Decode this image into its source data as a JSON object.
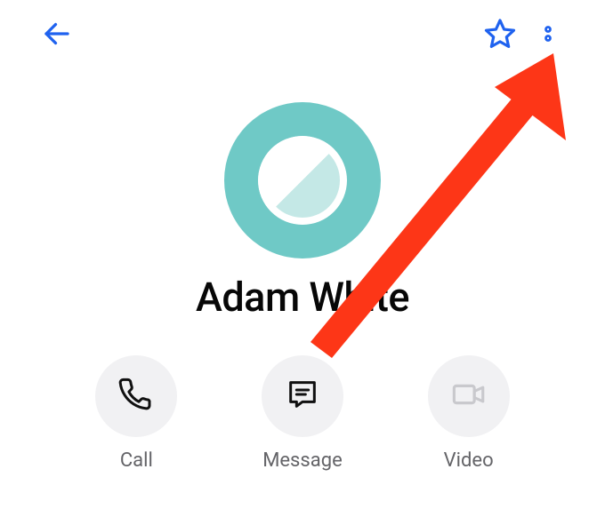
{
  "colors": {
    "accent": "#1f62ef",
    "avatar_bg": "#6fc9c6",
    "avatar_inner": "#c4e8e6",
    "action_bg": "#f1f1f3",
    "annotation": "#fd3617",
    "text_primary": "#070707",
    "text_secondary": "#646468"
  },
  "header": {
    "back_icon": "arrow-left",
    "favorite_icon": "star-outline",
    "menu_icon": "more-vertical"
  },
  "contact": {
    "name": "Adam White",
    "avatar_kind": "blocked-placeholder"
  },
  "actions": [
    {
      "id": "call",
      "label": "Call",
      "icon": "phone-icon"
    },
    {
      "id": "message",
      "label": "Message",
      "icon": "message-icon"
    },
    {
      "id": "video",
      "label": "Video",
      "icon": "video-icon"
    }
  ],
  "annotation": {
    "type": "arrow",
    "points_to": "more-menu"
  }
}
